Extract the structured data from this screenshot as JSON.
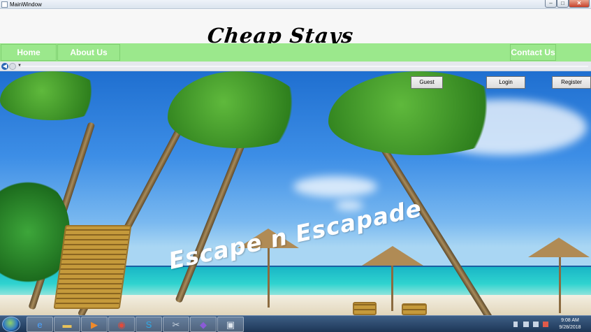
{
  "window": {
    "title": "MainWindow",
    "controls": {
      "minimize": "–",
      "maximize": "□",
      "close": "✕"
    }
  },
  "header": {
    "brand": "Cheap Stays"
  },
  "nav": {
    "items": [
      {
        "label": "Home"
      },
      {
        "label": "About Us"
      },
      {
        "label": "Contact Us"
      }
    ]
  },
  "hero": {
    "tagline": "Escape n Escapade",
    "buttons": {
      "guest": "Guest",
      "login": "Login",
      "register": "Register"
    }
  },
  "taskbar": {
    "apps": [
      {
        "icon": "internet-explorer-icon",
        "glyph": "e"
      },
      {
        "icon": "file-explorer-icon",
        "glyph": "▬"
      },
      {
        "icon": "media-player-icon",
        "glyph": "▶"
      },
      {
        "icon": "chrome-icon",
        "glyph": "◉"
      },
      {
        "icon": "skype-icon",
        "glyph": "S"
      },
      {
        "icon": "tools-icon",
        "glyph": "✂"
      },
      {
        "icon": "visual-studio-icon",
        "glyph": "◆"
      },
      {
        "icon": "app-window-icon",
        "glyph": "▣"
      }
    ],
    "clock_time": "9:08 AM",
    "clock_date": "9/28/2018"
  },
  "colors": {
    "nav_bg": "#9be88c",
    "header_bg": "#f7f7f7",
    "taskbar_bg": "#1d3656"
  }
}
